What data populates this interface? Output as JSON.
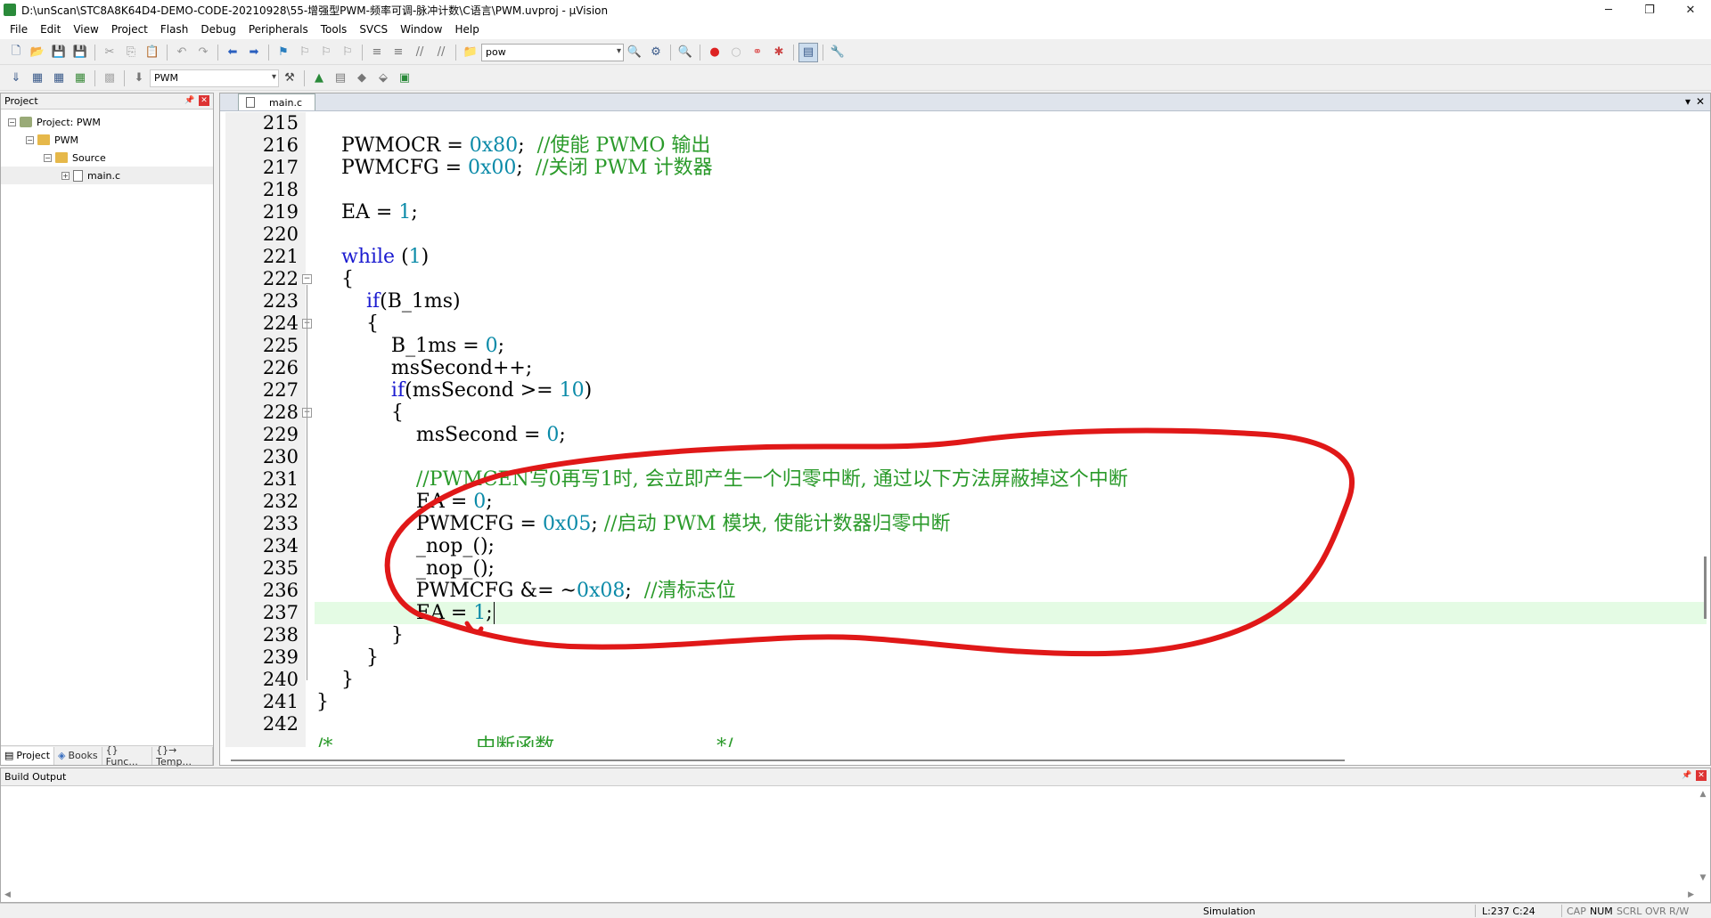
{
  "window": {
    "title": "D:\\unScan\\STC8A8K64D4-DEMO-CODE-20210928\\55-增强型PWM-频率可调-脉冲计数\\C语言\\PWM.uvproj - µVision",
    "minimize": "─",
    "maximize": "❐",
    "close": "✕"
  },
  "menu": [
    "File",
    "Edit",
    "View",
    "Project",
    "Flash",
    "Debug",
    "Peripherals",
    "Tools",
    "SVCS",
    "Window",
    "Help"
  ],
  "toolbar": {
    "find_combo_value": "pow",
    "target_combo_value": "PWM"
  },
  "project_panel": {
    "title": "Project",
    "tree": [
      {
        "label": "Project: PWM",
        "level": 0
      },
      {
        "label": "PWM",
        "level": 1
      },
      {
        "label": "Source",
        "level": 2
      },
      {
        "label": "main.c",
        "level": 3
      }
    ],
    "tabs": [
      "Project",
      "Books",
      "{} Func...",
      "{}→ Temp..."
    ]
  },
  "editor": {
    "tab_label": "main.c",
    "lines": [
      {
        "n": "215",
        "code": ""
      },
      {
        "n": "216",
        "code": "    PWMOCR = 0x80;  //使能 PWMO 输出"
      },
      {
        "n": "217",
        "code": "    PWMCFG = 0x00;  //关闭 PWM 计数器"
      },
      {
        "n": "218",
        "code": ""
      },
      {
        "n": "219",
        "code": "    EA = 1;"
      },
      {
        "n": "220",
        "code": ""
      },
      {
        "n": "221",
        "code": "    while (1)"
      },
      {
        "n": "222",
        "code": "    {"
      },
      {
        "n": "223",
        "code": "        if(B_1ms)"
      },
      {
        "n": "224",
        "code": "        {"
      },
      {
        "n": "225",
        "code": "            B_1ms = 0;"
      },
      {
        "n": "226",
        "code": "            msSecond++;"
      },
      {
        "n": "227",
        "code": "            if(msSecond >= 10)"
      },
      {
        "n": "228",
        "code": "            {"
      },
      {
        "n": "229",
        "code": "                msSecond = 0;"
      },
      {
        "n": "230",
        "code": ""
      },
      {
        "n": "231",
        "code": "                //PWMCEN写0再写1时, 会立即产生一个归零中断, 通过以下方法屏蔽掉这个中断"
      },
      {
        "n": "232",
        "code": "                EA = 0;"
      },
      {
        "n": "233",
        "code": "                PWMCFG = 0x05; //启动 PWM 模块, 使能计数器归零中断"
      },
      {
        "n": "234",
        "code": "                _nop_();"
      },
      {
        "n": "235",
        "code": "                _nop_();"
      },
      {
        "n": "236",
        "code": "                PWMCFG &= ~0x08;  //清标志位"
      },
      {
        "n": "237",
        "code": "                EA = 1;"
      },
      {
        "n": "238",
        "code": "            }"
      },
      {
        "n": "239",
        "code": "        }"
      },
      {
        "n": "240",
        "code": "    }"
      },
      {
        "n": "241",
        "code": "}"
      },
      {
        "n": "242",
        "code": ""
      }
    ],
    "partial_line": "/*...................... 中断函数 .........................*/",
    "current_line": 237
  },
  "build_output": {
    "title": "Build Output"
  },
  "statusbar": {
    "mode": "Simulation",
    "cursor": "L:237 C:24",
    "cap": "CAP",
    "num": "NUM",
    "scrl": "SCRL",
    "ovr": "OVR",
    "rw": "R/W"
  },
  "colors": {
    "keyword": "#1b1bd0",
    "number": "#0a8aa8",
    "comment": "#2a9a2a",
    "annotation": "#e01818",
    "current_line_bg": "#e4fbe4"
  }
}
